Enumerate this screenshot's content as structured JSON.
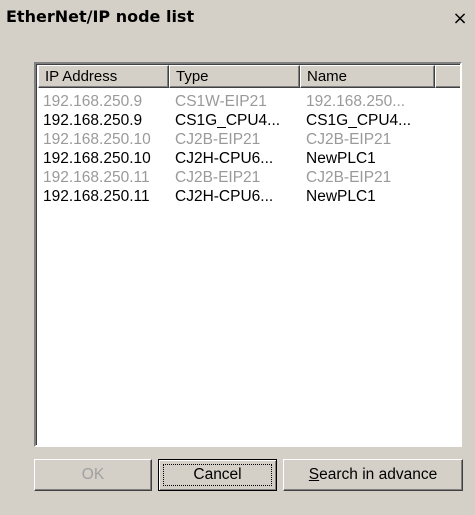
{
  "window": {
    "title": "EtherNet/IP node list",
    "close_label": "×"
  },
  "list": {
    "columns": [
      "IP Address",
      "Type",
      "Name",
      ""
    ],
    "rows": [
      {
        "ip": "192.168.250.9",
        "type": "CS1W-EIP21",
        "name": "192.168.250...",
        "state": "dim"
      },
      {
        "ip": "192.168.250.9",
        "type": "CS1G_CPU4...",
        "name": "CS1G_CPU4...",
        "state": "normal"
      },
      {
        "ip": "192.168.250.10",
        "type": "CJ2B-EIP21",
        "name": "CJ2B-EIP21",
        "state": "dim"
      },
      {
        "ip": "192.168.250.10",
        "type": "CJ2H-CPU6...",
        "name": "NewPLC1",
        "state": "normal"
      },
      {
        "ip": "192.168.250.11",
        "type": "CJ2B-EIP21",
        "name": "CJ2B-EIP21",
        "state": "dim"
      },
      {
        "ip": "192.168.250.11",
        "type": "CJ2H-CPU6...",
        "name": "NewPLC1",
        "state": "normal"
      }
    ]
  },
  "buttons": {
    "ok": "OK",
    "cancel": "Cancel",
    "search_prefix": "S",
    "search_rest": "earch in advance"
  },
  "colors": {
    "dialog_bg": "#d4d0c8",
    "list_bg": "#ffffff",
    "dim_text": "#9a9a9a"
  }
}
